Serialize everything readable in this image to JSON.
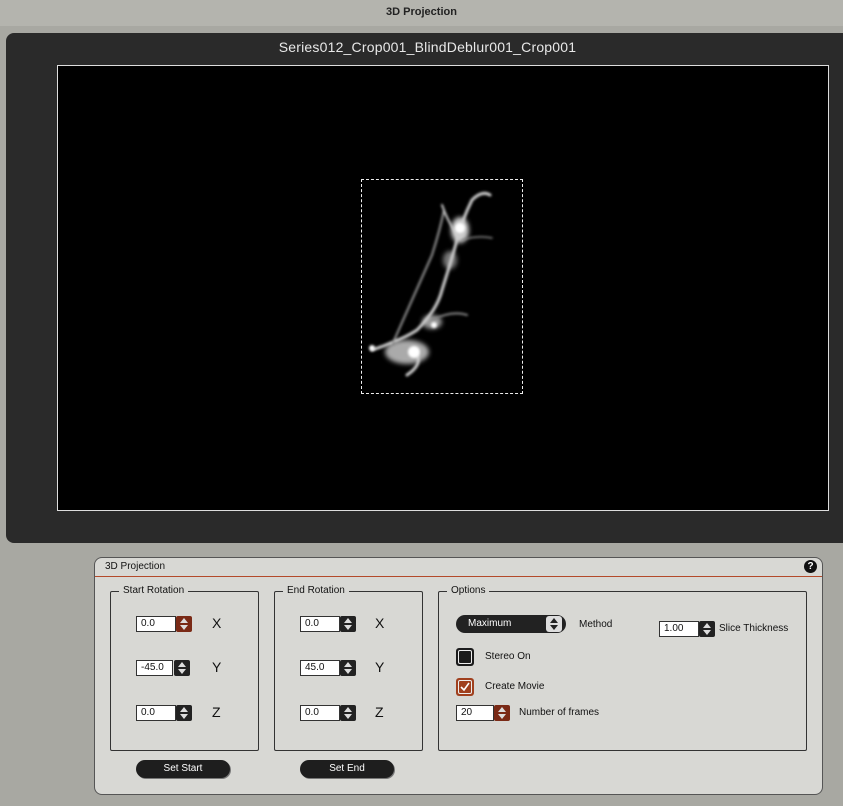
{
  "window": {
    "title": "3D Projection"
  },
  "viewer": {
    "image_title": "Series012_Crop001_BlindDeblur001_Crop001"
  },
  "panel": {
    "title": "3D Projection",
    "help_icon": "question-mark-icon",
    "help_glyph": "?",
    "start_rotation": {
      "legend": "Start Rotation",
      "x_value": "0.0",
      "y_value": "-45.0",
      "z_value": "0.0",
      "x_label": "X",
      "y_label": "Y",
      "z_label": "Z"
    },
    "end_rotation": {
      "legend": "End Rotation",
      "x_value": "0.0",
      "y_value": "45.0",
      "z_value": "0.0",
      "x_label": "X",
      "y_label": "Y",
      "z_label": "Z"
    },
    "options": {
      "legend": "Options",
      "method_value": "Maximum",
      "method_label": "Method",
      "slice_thickness_value": "1.00",
      "slice_thickness_label": "Slice Thickness",
      "stereo_label": "Stereo On",
      "stereo_checked": false,
      "create_movie_label": "Create Movie",
      "create_movie_checked": true,
      "frames_value": "20",
      "frames_label": "Number of frames"
    },
    "set_start_label": "Set Start",
    "set_end_label": "Set End"
  },
  "colors": {
    "accent": "#a0401e",
    "panel_bg": "#d8d8d4",
    "viewer_bg": "#2a2a2a"
  }
}
